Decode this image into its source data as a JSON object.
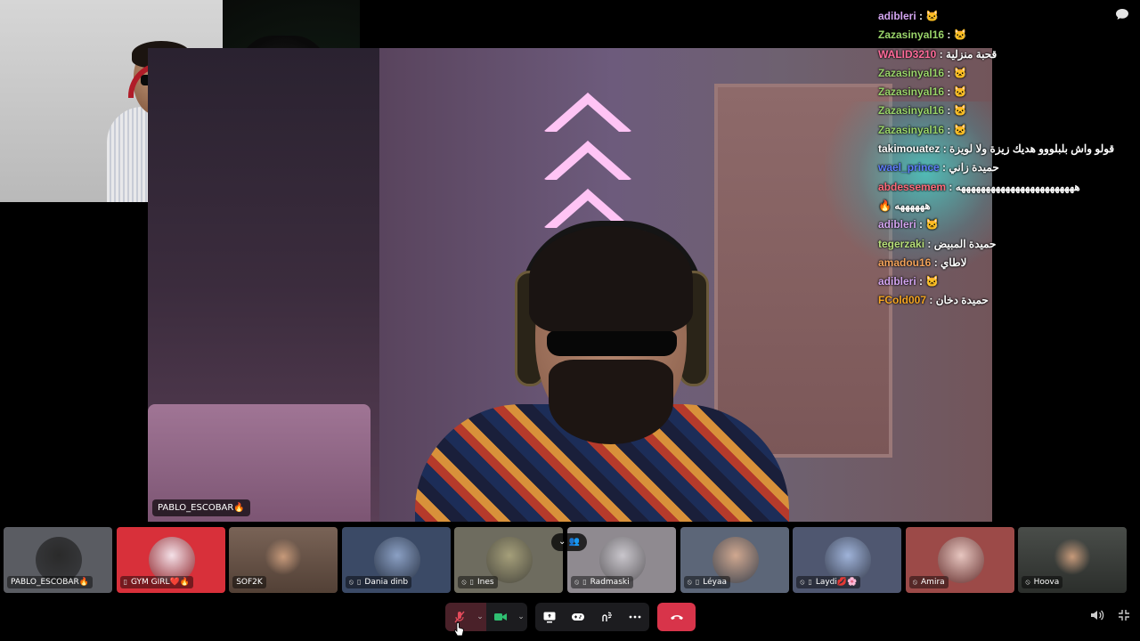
{
  "main_stream": {
    "name_tag": "PABLO_ESCOBAR🔥"
  },
  "chat": {
    "messages": [
      {
        "user": "adibleri",
        "color": "#d3a5f0",
        "text": "🐱"
      },
      {
        "user": "Zazasinyal16",
        "color": "#9ad46a",
        "text": "🐱"
      },
      {
        "user": "WALID3210",
        "color": "#ff6b9a",
        "text": "قحبة منزلية"
      },
      {
        "user": "Zazasinyal16",
        "color": "#9ad46a",
        "text": "🐱"
      },
      {
        "user": "Zazasinyal16",
        "color": "#9ad46a",
        "text": "🐱"
      },
      {
        "user": "Zazasinyal16",
        "color": "#9ad46a",
        "text": "🐱"
      },
      {
        "user": "Zazasinyal16",
        "color": "#9ad46a",
        "text": "🐱"
      },
      {
        "user": "takimouatez",
        "color": "#ffffff",
        "text": "قولو واش بلبلووو هديك زيزة ولا لويزة"
      },
      {
        "user": "wael_prince",
        "color": "#5f7fff",
        "text": "حميدة زاني"
      },
      {
        "user": "abdessemem",
        "color": "#ff6a7a",
        "text": "ههههههههههههههههههههههههه"
      },
      {
        "user": "",
        "color": "#ffffff",
        "text": "🔥 ههههههه"
      },
      {
        "user": "adibleri",
        "color": "#d3a5f0",
        "text": "🐱"
      },
      {
        "user": "tegerzaki",
        "color": "#b8e07a",
        "text": "حميدة المبيض"
      },
      {
        "user": "amadou16",
        "color": "#f2a25a",
        "text": "لاطاي"
      },
      {
        "user": "adibleri",
        "color": "#d3a5f0",
        "text": "🐱"
      },
      {
        "user": "FCold007",
        "color": "#f5a623",
        "text": "حميدة دخان"
      }
    ],
    "separator": ":"
  },
  "participants": [
    {
      "name": "PABLO_ESCOBAR🔥",
      "bg": "#5a5c62",
      "avatar": "#2a2a2a",
      "muted": false,
      "device": "camera"
    },
    {
      "name": "GYM GIRL❤️🔥",
      "bg": "#d8303a",
      "avatar": "#f4e1e8",
      "muted": false,
      "device": "phone"
    },
    {
      "name": "SOF2K",
      "bg": "#6e5648",
      "avatar": "none",
      "muted": false,
      "device": "none"
    },
    {
      "name": "Dania dinb",
      "bg": "#3b4a66",
      "avatar": "#8ba0c4",
      "muted": true,
      "device": "phone"
    },
    {
      "name": "Ines",
      "bg": "#6e6c5f",
      "avatar": "#a59f7a",
      "muted": true,
      "device": "phone"
    },
    {
      "name": "Radmaski",
      "bg": "#8f8a90",
      "avatar": "#c9c6cc",
      "muted": true,
      "device": "phone"
    },
    {
      "name": "Léyaa",
      "bg": "#5c6678",
      "avatar": "#d0a890",
      "muted": true,
      "device": "phone"
    },
    {
      "name": "Laydi💋🌸",
      "bg": "#4f5770",
      "avatar": "#9fb3d9",
      "muted": true,
      "device": "phone"
    },
    {
      "name": "Amira",
      "bg": "#9c4a48",
      "avatar": "#e7c6c0",
      "muted": true,
      "device": "none"
    },
    {
      "name": "Hoova",
      "bg": "#3a3e3a",
      "avatar": "none",
      "muted": true,
      "device": "none"
    }
  ],
  "icons": {
    "mic_muted": "mic-muted-icon",
    "camera": "camera-icon",
    "screen_share": "screen-share-icon",
    "activity": "gamepad-icon",
    "soundboard": "soundboard-icon",
    "more": "more-icon",
    "end_call": "phone-hangup-icon",
    "volume": "volume-icon",
    "minimize": "minimize-icon",
    "chat": "chat-bubble-icon"
  },
  "colors": {
    "end_call": "#d8344a",
    "camera_on": "#2fbf71",
    "mic_muted": "#e24a5a"
  }
}
